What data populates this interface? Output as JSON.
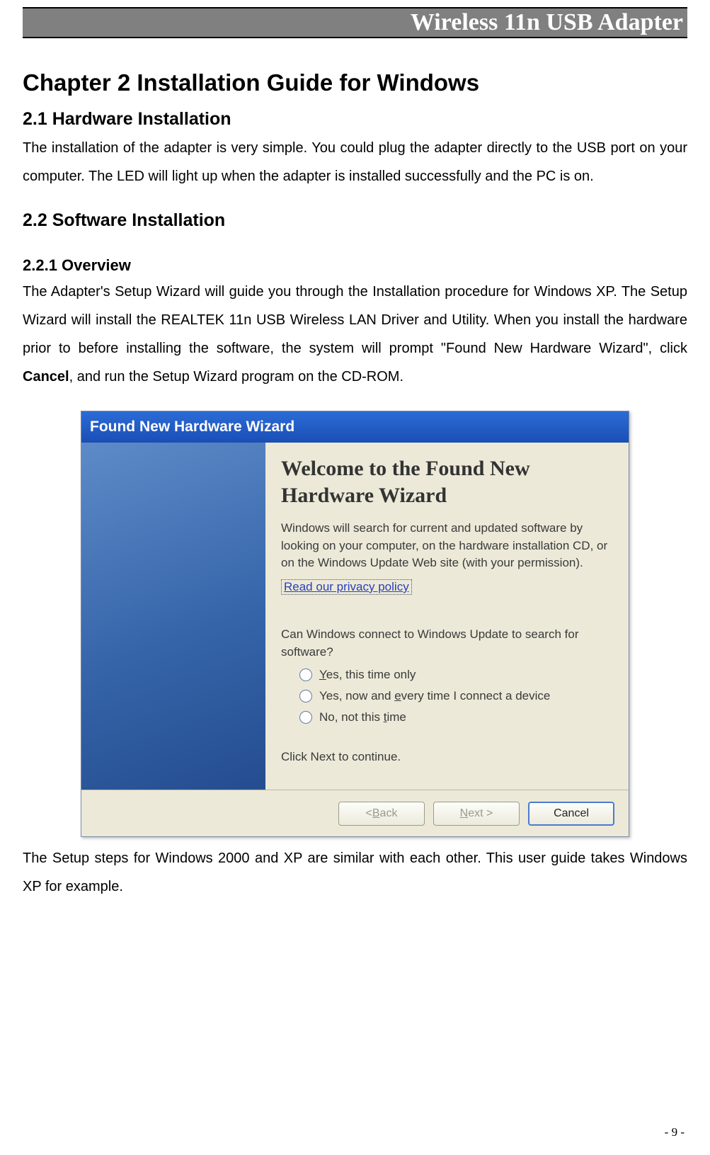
{
  "header": {
    "title": "Wireless 11n USB Adapter"
  },
  "chapter": {
    "title": "Chapter 2   Installation Guide for Windows"
  },
  "section_2_1": {
    "title": "2.1    Hardware Installation",
    "body": "The installation of the adapter is very simple. You could plug the adapter directly to the USB port on your computer. The LED will light up when the adapter is installed successfully and the PC is on."
  },
  "section_2_2": {
    "title": "2.2    Software Installation"
  },
  "section_2_2_1": {
    "title": "2.2.1    Overview",
    "body_pre": "The Adapter's Setup Wizard will guide you through the Installation procedure for Windows XP. The Setup Wizard will install the REALTEK 11n USB Wireless LAN Driver and Utility. When you install the hardware prior to before installing the software, the system will prompt \"Found New Hardware Wizard\", click ",
    "body_bold": "Cancel",
    "body_post": ", and run the Setup Wizard program on the CD-ROM."
  },
  "dialog": {
    "title": "Found New Hardware Wizard",
    "heading": "Welcome to the Found New Hardware Wizard",
    "para1": "Windows will search for current and updated software by looking on your computer, on the hardware installation CD, or on the Windows Update Web site (with your permission).",
    "privacy": "Read our privacy policy",
    "question": "Can Windows connect to Windows Update to search for software?",
    "options": {
      "opt1_pre": "Y",
      "opt1_post": "es, this time only",
      "opt2_pre": "Yes, now and ",
      "opt2_u": "e",
      "opt2_post": "very time I connect a device",
      "opt3_pre": "No, not this ",
      "opt3_u": "t",
      "opt3_post": "ime"
    },
    "continue_text": "Click Next to continue.",
    "buttons": {
      "back_pre": "< ",
      "back_u": "B",
      "back_post": "ack",
      "next_u": "N",
      "next_post": "ext >",
      "cancel": "Cancel"
    }
  },
  "after_dialog": "The Setup steps for Windows 2000 and XP are similar with each other. This user guide takes Windows XP for example.",
  "footer": {
    "page": "- 9 -"
  }
}
